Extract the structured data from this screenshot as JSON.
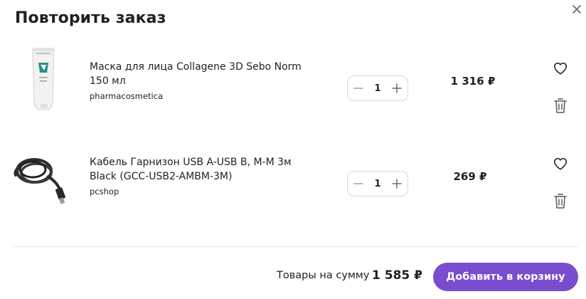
{
  "modal": {
    "title": "Повторить заказ"
  },
  "items": [
    {
      "name": "Маска для лица Collagene 3D Sebo Norm 150 мл",
      "seller": "pharmacosmetica",
      "quantity": "1",
      "price": "1 316 ₽",
      "image": "face-mask-tube-image"
    },
    {
      "name": "Кабель Гарнизон USB A-USB B, M-M 3м Black (GCC-USB2-AMBM-3M)",
      "seller": "pcshop",
      "quantity": "1",
      "price": "269 ₽",
      "image": "usb-cable-image"
    }
  ],
  "footer": {
    "total_label": "Товары на сумму",
    "total_value": "1 585 ₽",
    "add_button": "Добавить в корзину"
  },
  "colors": {
    "accent": "#7a4cce",
    "text": "#1f2024",
    "icon": "#2a2b30",
    "border": "#d5d7dc"
  },
  "icons": [
    "close-icon",
    "minus-icon",
    "plus-icon",
    "heart-icon",
    "trash-icon"
  ]
}
